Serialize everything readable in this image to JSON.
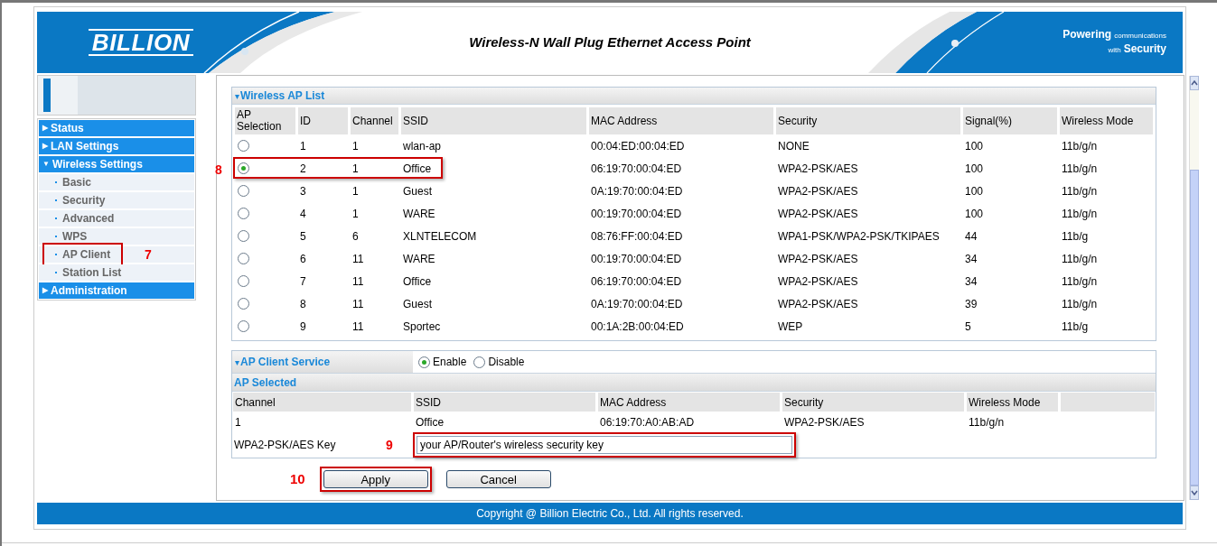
{
  "header": {
    "logo": "BILLION",
    "title": "Wireless-N Wall Plug Ethernet Access Point",
    "tagline": [
      {
        "words": [
          {
            "text": "Powering",
            "emphasis": true
          },
          {
            "text": "communications",
            "emphasis": false
          }
        ]
      },
      {
        "words": [
          {
            "text": "with",
            "emphasis": false
          },
          {
            "text": "Security",
            "emphasis": true
          }
        ]
      }
    ]
  },
  "sidebar": {
    "menu": [
      {
        "caret": "▶",
        "label": "Status"
      },
      {
        "caret": "▶",
        "label": "LAN Settings"
      },
      {
        "caret": "▼",
        "label": "Wireless Settings",
        "children": [
          {
            "label": "Basic"
          },
          {
            "label": "Security"
          },
          {
            "label": "Advanced"
          },
          {
            "label": "WPS"
          },
          {
            "label": "AP Client",
            "callout": "7"
          },
          {
            "label": "Station List"
          }
        ]
      },
      {
        "caret": "▶",
        "label": "Administration"
      }
    ]
  },
  "ap_list": {
    "caret": "▾",
    "title": "Wireless AP List",
    "selection_column": "AP Selection",
    "columns": [
      "ID",
      "Channel",
      "SSID",
      "MAC Address",
      "Security",
      "Signal(%)",
      "Wireless Mode"
    ],
    "rows": [
      {
        "selected": false,
        "cells": [
          "1",
          "1",
          "wlan-ap",
          "00:04:ED:00:04:ED",
          "NONE",
          "100",
          "11b/g/n"
        ]
      },
      {
        "selected": true,
        "callout": "8",
        "cells": [
          "2",
          "1",
          "Office",
          "06:19:70:00:04:ED",
          "WPA2-PSK/AES",
          "100",
          "11b/g/n"
        ]
      },
      {
        "selected": false,
        "cells": [
          "3",
          "1",
          "Guest",
          "0A:19:70:00:04:ED",
          "WPA2-PSK/AES",
          "100",
          "11b/g/n"
        ]
      },
      {
        "selected": false,
        "cells": [
          "4",
          "1",
          "WARE",
          "00:19:70:00:04:ED",
          "WPA2-PSK/AES",
          "100",
          "11b/g/n"
        ]
      },
      {
        "selected": false,
        "cells": [
          "5",
          "6",
          "XLNTELECOM",
          "08:76:FF:00:04:ED",
          "WPA1-PSK/WPA2-PSK/TKIPAES",
          "44",
          "11b/g"
        ]
      },
      {
        "selected": false,
        "cells": [
          "6",
          "11",
          "WARE",
          "00:19:70:00:04:ED",
          "WPA2-PSK/AES",
          "34",
          "11b/g/n"
        ]
      },
      {
        "selected": false,
        "cells": [
          "7",
          "11",
          "Office",
          "06:19:70:00:04:ED",
          "WPA2-PSK/AES",
          "34",
          "11b/g/n"
        ]
      },
      {
        "selected": false,
        "cells": [
          "8",
          "11",
          "Guest",
          "0A:19:70:00:04:ED",
          "WPA2-PSK/AES",
          "39",
          "11b/g/n"
        ]
      },
      {
        "selected": false,
        "cells": [
          "9",
          "11",
          "Sportec",
          "00:1A:2B:00:04:ED",
          "WEP",
          "5",
          "11b/g"
        ]
      }
    ]
  },
  "ap_client_service": {
    "caret": "▾",
    "title": "AP Client Service",
    "options": [
      {
        "label": "Enable",
        "selected": true
      },
      {
        "label": "Disable",
        "selected": false
      }
    ],
    "ap_selected": {
      "title": "AP Selected",
      "columns": [
        "Channel",
        "SSID",
        "MAC Address",
        "Security",
        "Wireless Mode"
      ],
      "values": [
        "1",
        "Office",
        "06:19:70:A0:AB:AD",
        "WPA2-PSK/AES",
        "11b/g/n"
      ]
    },
    "key": {
      "label": "WPA2-PSK/AES Key",
      "value": "your AP/Router's wireless security key",
      "callout": "9"
    }
  },
  "buttons": [
    {
      "label": "Apply",
      "callout": "10"
    },
    {
      "label": "Cancel"
    }
  ],
  "footer": {
    "copyright": "Copyright @ Billion Electric Co., Ltd. All rights reserved."
  }
}
